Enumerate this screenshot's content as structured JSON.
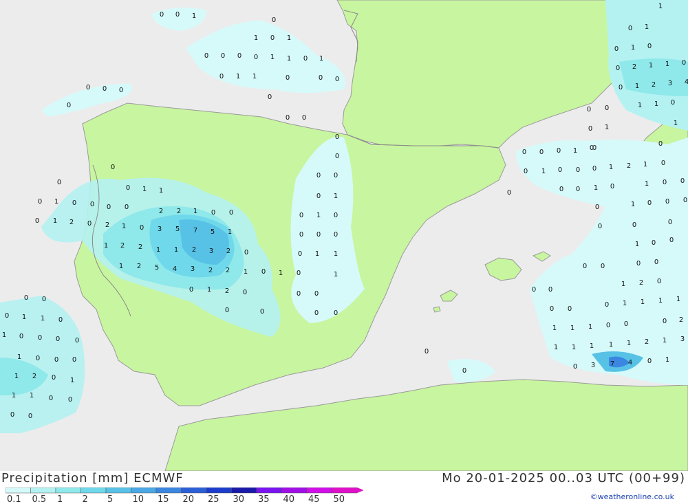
{
  "header": {
    "title": "Precipitation [mm] ECMWF",
    "datetime": "Mo 20-01-2025 00..03 UTC (00+99)",
    "credit": "©weatheronline.co.uk"
  },
  "colors": {
    "sea": "#ececec",
    "land": "#c8f59f",
    "border": "#8a8a8a"
  },
  "legend": [
    {
      "label": "0.1",
      "color": "#d6fafa"
    },
    {
      "label": "0.5",
      "color": "#b4f2f2"
    },
    {
      "label": "1",
      "color": "#8fe8ea"
    },
    {
      "label": "2",
      "color": "#6fd8ea"
    },
    {
      "label": "5",
      "color": "#58c2e6"
    },
    {
      "label": "10",
      "color": "#4aa8e4"
    },
    {
      "label": "15",
      "color": "#3a86e0"
    },
    {
      "label": "20",
      "color": "#2a5fd6"
    },
    {
      "label": "25",
      "color": "#1c3ccc"
    },
    {
      "label": "30",
      "color": "#1a1aa8"
    },
    {
      "label": "35",
      "color": "#7a14f0"
    },
    {
      "label": "40",
      "color": "#a010e6"
    },
    {
      "label": "45",
      "color": "#d10ee8"
    },
    {
      "label": "50",
      "color": "#e010c8"
    }
  ],
  "values": [
    [
      "0",
      235,
      24
    ],
    [
      "0",
      258,
      24
    ],
    [
      "1",
      282,
      26
    ],
    [
      "0",
      398,
      32
    ],
    [
      "1",
      372,
      58
    ],
    [
      "0",
      396,
      58
    ],
    [
      "1",
      420,
      58
    ],
    [
      "0",
      300,
      84
    ],
    [
      "0",
      324,
      84
    ],
    [
      "0",
      348,
      84
    ],
    [
      "0",
      372,
      86
    ],
    [
      "1",
      396,
      86
    ],
    [
      "1",
      420,
      88
    ],
    [
      "0",
      444,
      88
    ],
    [
      "1",
      467,
      88
    ],
    [
      "0",
      322,
      114
    ],
    [
      "1",
      346,
      114
    ],
    [
      "1",
      370,
      114
    ],
    [
      "0",
      418,
      116
    ],
    [
      "0",
      466,
      116
    ],
    [
      "0",
      490,
      118
    ],
    [
      "0",
      128,
      130
    ],
    [
      "0",
      152,
      132
    ],
    [
      "0",
      176,
      134
    ],
    [
      "0",
      100,
      156
    ],
    [
      "0",
      392,
      144
    ],
    [
      "0",
      418,
      174
    ],
    [
      "0",
      442,
      174
    ],
    [
      "0",
      490,
      202
    ],
    [
      "0",
      490,
      230
    ],
    [
      "0",
      463,
      258
    ],
    [
      "0",
      488,
      258
    ],
    [
      "0",
      463,
      288
    ],
    [
      "1",
      488,
      288
    ],
    [
      "0",
      438,
      316
    ],
    [
      "1",
      463,
      316
    ],
    [
      "0",
      488,
      316
    ],
    [
      "0",
      438,
      344
    ],
    [
      "0",
      463,
      344
    ],
    [
      "0",
      488,
      344
    ],
    [
      "0",
      436,
      372
    ],
    [
      "1",
      461,
      372
    ],
    [
      "1",
      488,
      372
    ],
    [
      "0",
      434,
      400
    ],
    [
      "1",
      488,
      402
    ],
    [
      "0",
      434,
      430
    ],
    [
      "0",
      460,
      430
    ],
    [
      "0",
      460,
      458
    ],
    [
      "0",
      488,
      458
    ],
    [
      "0",
      164,
      246
    ],
    [
      "0",
      186,
      276
    ],
    [
      "1",
      210,
      278
    ],
    [
      "1",
      234,
      280
    ],
    [
      "0",
      86,
      268
    ],
    [
      "0",
      58,
      296
    ],
    [
      "1",
      82,
      296
    ],
    [
      "0",
      108,
      298
    ],
    [
      "0",
      134,
      300
    ],
    [
      "0",
      158,
      304
    ],
    [
      "0",
      184,
      304
    ],
    [
      "2",
      234,
      310
    ],
    [
      "2",
      260,
      310
    ],
    [
      "1",
      284,
      310
    ],
    [
      "0",
      310,
      312
    ],
    [
      "0",
      336,
      312
    ],
    [
      "0",
      54,
      324
    ],
    [
      "1",
      80,
      324
    ],
    [
      "2",
      104,
      326
    ],
    [
      "0",
      130,
      328
    ],
    [
      "2",
      156,
      330
    ],
    [
      "1",
      180,
      332
    ],
    [
      "0",
      206,
      334
    ],
    [
      "3",
      232,
      336
    ],
    [
      "5",
      258,
      336
    ],
    [
      "7",
      284,
      338
    ],
    [
      "5",
      309,
      340
    ],
    [
      "1",
      334,
      340
    ],
    [
      "1",
      154,
      360
    ],
    [
      "2",
      178,
      360
    ],
    [
      "2",
      204,
      362
    ],
    [
      "1",
      230,
      366
    ],
    [
      "1",
      256,
      366
    ],
    [
      "2",
      282,
      366
    ],
    [
      "3",
      307,
      368
    ],
    [
      "2",
      332,
      368
    ],
    [
      "0",
      358,
      370
    ],
    [
      "1",
      176,
      390
    ],
    [
      "2",
      202,
      390
    ],
    [
      "5",
      228,
      392
    ],
    [
      "4",
      254,
      394
    ],
    [
      "3",
      280,
      394
    ],
    [
      "2",
      306,
      396
    ],
    [
      "2",
      331,
      396
    ],
    [
      "1",
      357,
      398
    ],
    [
      "0",
      383,
      398
    ],
    [
      "1",
      408,
      400
    ],
    [
      "0",
      278,
      424
    ],
    [
      "1",
      304,
      424
    ],
    [
      "2",
      330,
      426
    ],
    [
      "0",
      356,
      428
    ],
    [
      "0",
      330,
      454
    ],
    [
      "0",
      381,
      456
    ],
    [
      "0",
      38,
      436
    ],
    [
      "0",
      64,
      438
    ],
    [
      "0",
      10,
      462
    ],
    [
      "1",
      35,
      464
    ],
    [
      "1",
      62,
      466
    ],
    [
      "0",
      88,
      468
    ],
    [
      "1",
      6,
      490
    ],
    [
      "0",
      31,
      492
    ],
    [
      "0",
      58,
      494
    ],
    [
      "0",
      84,
      496
    ],
    [
      "0",
      112,
      498
    ],
    [
      "1",
      28,
      522
    ],
    [
      "0",
      55,
      524
    ],
    [
      "0",
      82,
      526
    ],
    [
      "0",
      108,
      526
    ],
    [
      "1",
      24,
      550
    ],
    [
      "2",
      50,
      550
    ],
    [
      "0",
      78,
      552
    ],
    [
      "1",
      105,
      556
    ],
    [
      "1",
      20,
      578
    ],
    [
      "1",
      46,
      578
    ],
    [
      "0",
      74,
      582
    ],
    [
      "0",
      102,
      584
    ],
    [
      "0",
      18,
      606
    ],
    [
      "0",
      44,
      608
    ],
    [
      "0",
      620,
      514
    ],
    [
      "0",
      675,
      542
    ],
    [
      "0",
      740,
      283
    ],
    [
      "1",
      960,
      12
    ],
    [
      "0",
      916,
      44
    ],
    [
      "1",
      940,
      42
    ],
    [
      "0",
      896,
      74
    ],
    [
      "1",
      920,
      72
    ],
    [
      "0",
      944,
      70
    ],
    [
      "0",
      898,
      102
    ],
    [
      "2",
      922,
      100
    ],
    [
      "1",
      946,
      98
    ],
    [
      "1",
      970,
      96
    ],
    [
      "0",
      994,
      94
    ],
    [
      "0",
      902,
      130
    ],
    [
      "1",
      926,
      128
    ],
    [
      "2",
      950,
      126
    ],
    [
      "3",
      974,
      124
    ],
    [
      "4",
      998,
      122
    ],
    [
      "1",
      930,
      156
    ],
    [
      "1",
      954,
      154
    ],
    [
      "0",
      978,
      152
    ],
    [
      "0",
      856,
      162
    ],
    [
      "0",
      882,
      160
    ],
    [
      "0",
      858,
      190
    ],
    [
      "1",
      882,
      188
    ],
    [
      "1",
      982,
      182
    ],
    [
      "0",
      860,
      218
    ],
    [
      "0",
      960,
      212
    ],
    [
      "0",
      762,
      224
    ],
    [
      "0",
      787,
      224
    ],
    [
      "0",
      812,
      222
    ],
    [
      "1",
      836,
      222
    ],
    [
      "0",
      864,
      218
    ],
    [
      "0",
      764,
      252
    ],
    [
      "1",
      790,
      252
    ],
    [
      "0",
      814,
      250
    ],
    [
      "0",
      840,
      250
    ],
    [
      "0",
      864,
      248
    ],
    [
      "1",
      888,
      246
    ],
    [
      "2",
      914,
      244
    ],
    [
      "1",
      938,
      242
    ],
    [
      "0",
      964,
      240
    ],
    [
      "0",
      816,
      278
    ],
    [
      "0",
      840,
      278
    ],
    [
      "1",
      866,
      276
    ],
    [
      "0",
      890,
      274
    ],
    [
      "1",
      940,
      270
    ],
    [
      "0",
      966,
      268
    ],
    [
      "0",
      992,
      266
    ],
    [
      "0",
      868,
      304
    ],
    [
      "1",
      920,
      300
    ],
    [
      "0",
      944,
      298
    ],
    [
      "0",
      970,
      296
    ],
    [
      "0",
      996,
      294
    ],
    [
      "0",
      872,
      332
    ],
    [
      "0",
      922,
      330
    ],
    [
      "0",
      974,
      326
    ],
    [
      "1",
      926,
      358
    ],
    [
      "0",
      950,
      356
    ],
    [
      "0",
      976,
      352
    ],
    [
      "0",
      850,
      390
    ],
    [
      "0",
      876,
      390
    ],
    [
      "0",
      928,
      386
    ],
    [
      "0",
      954,
      384
    ],
    [
      "0",
      776,
      424
    ],
    [
      "0",
      800,
      424
    ],
    [
      "1",
      906,
      416
    ],
    [
      "2",
      932,
      414
    ],
    [
      "0",
      958,
      412
    ],
    [
      "0",
      802,
      452
    ],
    [
      "0",
      828,
      452
    ],
    [
      "0",
      882,
      446
    ],
    [
      "1",
      908,
      444
    ],
    [
      "1",
      934,
      442
    ],
    [
      "1",
      960,
      440
    ],
    [
      "1",
      986,
      438
    ],
    [
      "1",
      806,
      480
    ],
    [
      "1",
      832,
      480
    ],
    [
      "1",
      858,
      478
    ],
    [
      "0",
      884,
      476
    ],
    [
      "0",
      910,
      474
    ],
    [
      "0",
      966,
      470
    ],
    [
      "2",
      990,
      468
    ],
    [
      "1",
      808,
      508
    ],
    [
      "1",
      834,
      508
    ],
    [
      "1",
      860,
      506
    ],
    [
      "1",
      888,
      504
    ],
    [
      "1",
      914,
      502
    ],
    [
      "2",
      940,
      500
    ],
    [
      "1",
      966,
      498
    ],
    [
      "3",
      992,
      496
    ],
    [
      "0",
      836,
      536
    ],
    [
      "3",
      862,
      534
    ],
    [
      "7",
      890,
      532
    ],
    [
      "4",
      916,
      530
    ],
    [
      "0",
      944,
      528
    ],
    [
      "1",
      970,
      526
    ]
  ]
}
